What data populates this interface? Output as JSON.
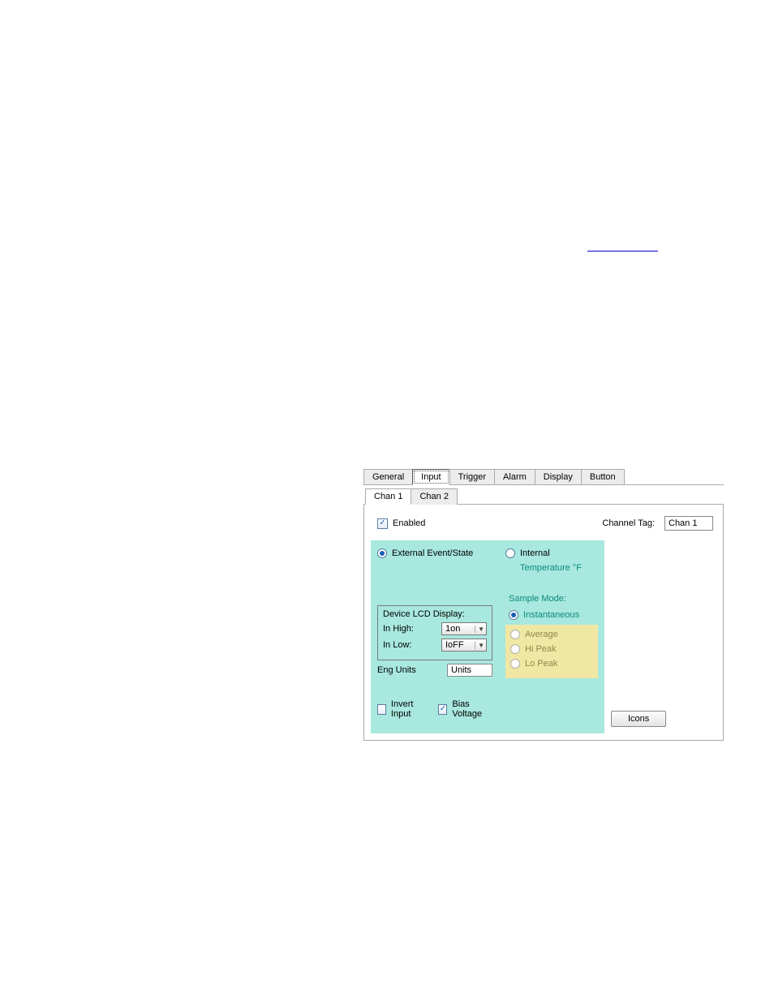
{
  "link_underline_color": "#0000cc",
  "tabs": {
    "main": [
      "General",
      "Input",
      "Trigger",
      "Alarm",
      "Display",
      "Button"
    ],
    "main_active_index": 1,
    "channel": [
      "Chan 1",
      "Chan 2"
    ],
    "channel_active_index": 0
  },
  "panel": {
    "enabled_label": "Enabled",
    "enabled_checked": true,
    "channel_tag_label": "Channel Tag:",
    "channel_tag_value": "Chan 1",
    "left": {
      "source_label": "External Event/State",
      "source_selected": true,
      "lcd_legend": "Device LCD Display:",
      "in_high_label": "In High:",
      "in_high_value": "1on",
      "in_low_label": "In Low:",
      "in_low_value": "IoFF",
      "eng_units_label": "Eng Units",
      "eng_units_value": "Units",
      "invert_label": "Invert Input",
      "invert_checked": false,
      "bias_label": "Bias Voltage",
      "bias_checked": true
    },
    "mid": {
      "internal_label": "Internal",
      "internal_selected": false,
      "temperature_label": "Temperature °F",
      "sample_mode_label": "Sample Mode:",
      "modes": {
        "instantaneous": "Instantaneous",
        "average": "Average",
        "hi_peak": "Hi Peak",
        "lo_peak": "Lo Peak"
      },
      "selected_mode": "instantaneous"
    },
    "icons_button_label": "Icons"
  }
}
